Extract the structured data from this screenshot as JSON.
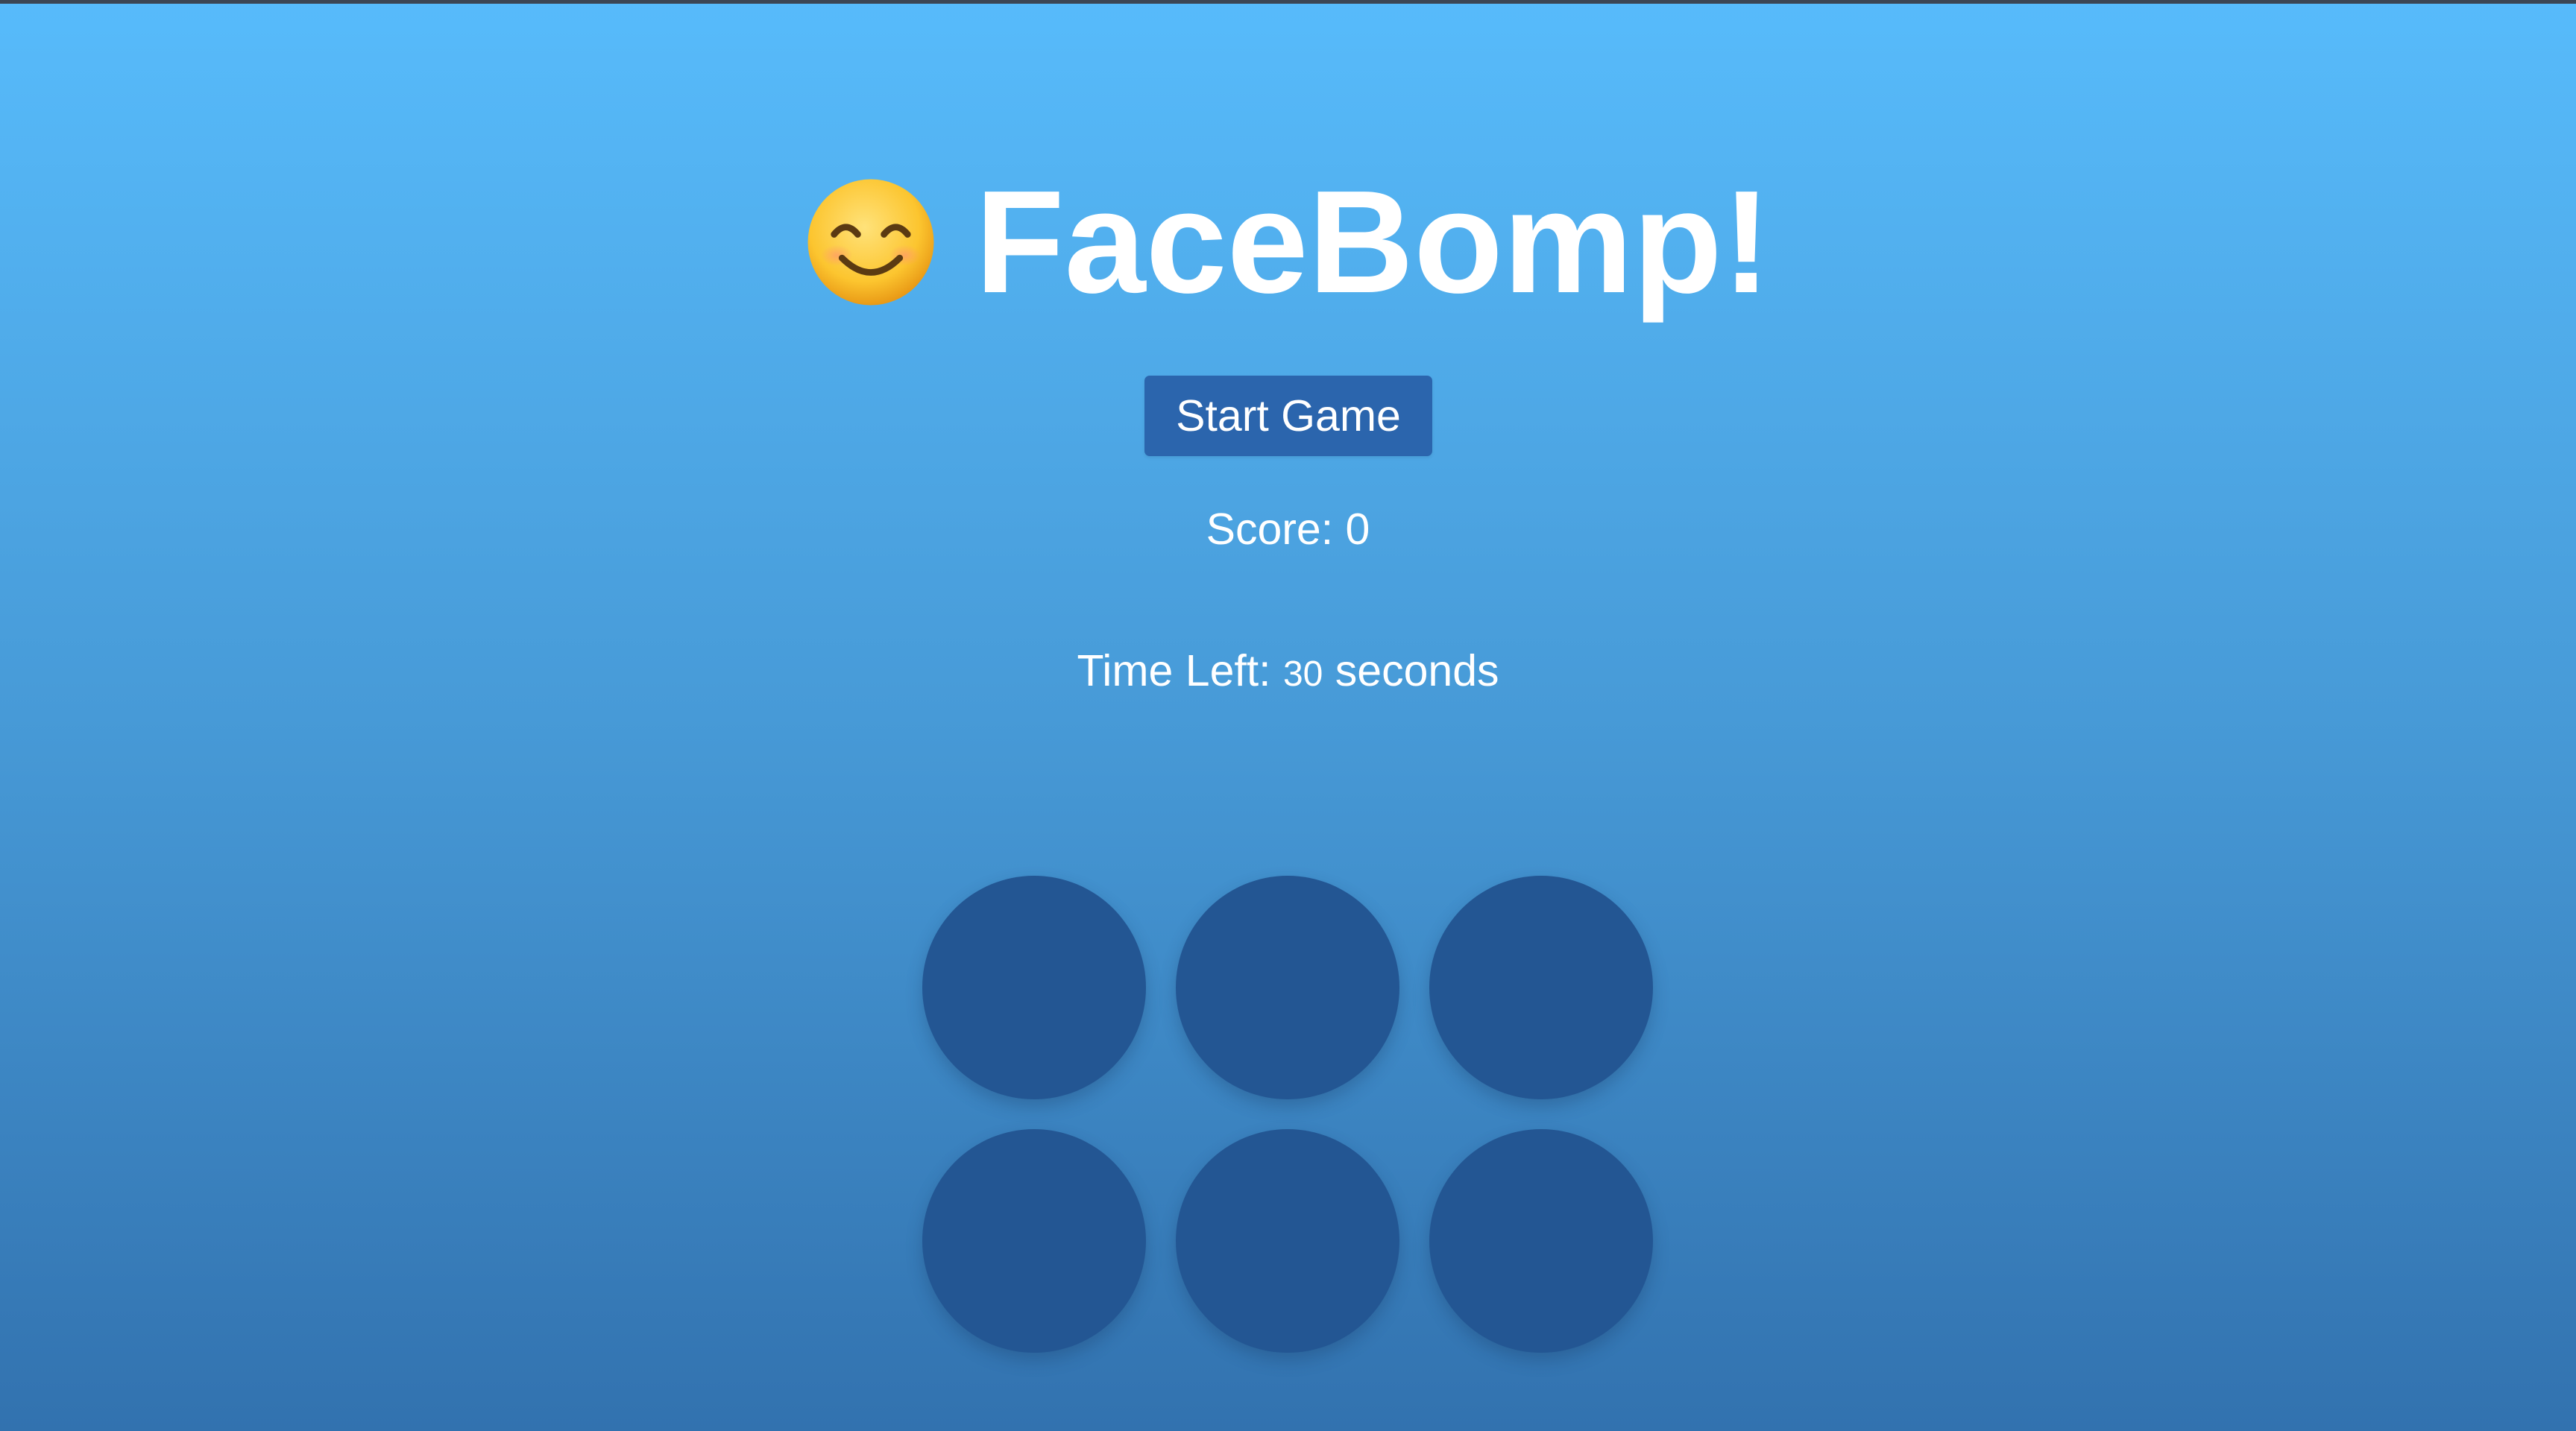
{
  "game": {
    "title_emoji_name": "smiling-face-icon",
    "title": "FaceBomp!",
    "start_button_label": "Start Game",
    "score_label": "Score:",
    "score_value": "0",
    "time_label": "Time Left:",
    "time_value": "30",
    "time_unit": "seconds",
    "hole_count": 6
  },
  "colors": {
    "background_top": "#57bbfb",
    "background_bottom": "#3272af",
    "button": "#2b65ad",
    "hole": "#235693",
    "text": "#ffffff"
  }
}
